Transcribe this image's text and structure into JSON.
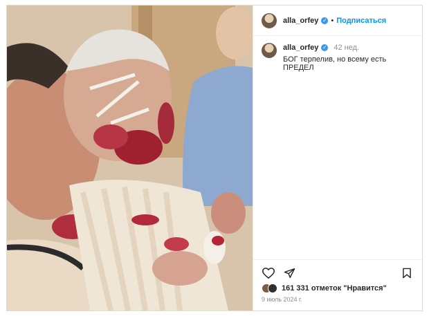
{
  "post": {
    "username": "alla_orfey",
    "verified_symbol": "✓",
    "follow_label": "Подписаться",
    "separator": "•",
    "caption": {
      "username": "alla_orfey",
      "time_ago": "42 нед.",
      "text": "БОГ терпелив, но всему есть ПРЕДЕЛ"
    },
    "likes_text": "161 331 отметок \"Нравится\"",
    "date": "9 июль 2024 г."
  },
  "icons": {
    "like": "heart-outline-icon",
    "share": "paper-plane-icon",
    "save": "bookmark-icon",
    "verified": "verified-badge-icon"
  },
  "colors": {
    "link_blue": "#0095f6",
    "verified_blue": "#3897f0",
    "muted": "#8e8e8e",
    "border": "#dbdbdb"
  }
}
